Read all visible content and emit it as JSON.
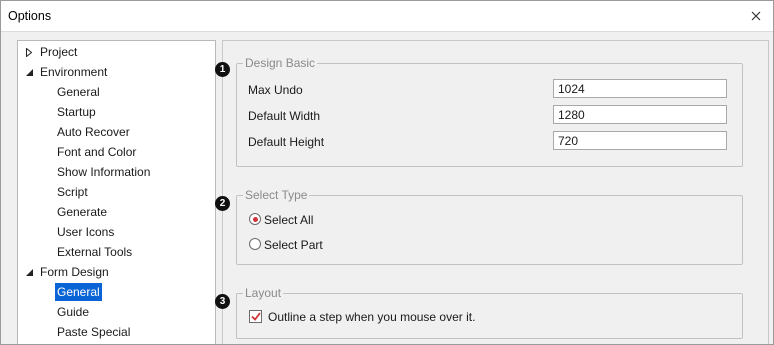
{
  "window": {
    "title": "Options"
  },
  "tree": {
    "project": "Project",
    "environment": "Environment",
    "environment_children": [
      "General",
      "Startup",
      "Auto Recover",
      "Font and Color",
      "Show Information",
      "Script",
      "Generate",
      "User Icons",
      "External Tools"
    ],
    "form_design": "Form Design",
    "form_design_children": [
      "General",
      "Guide",
      "Paste Special"
    ],
    "selected": "Form Design > General"
  },
  "design_basic": {
    "title": "Design Basic",
    "max_undo_label": "Max Undo",
    "max_undo_value": "1024",
    "default_width_label": "Default Width",
    "default_width_value": "1280",
    "default_height_label": "Default Height",
    "default_height_value": "720"
  },
  "select_type": {
    "title": "Select Type",
    "option_all": "Select All",
    "option_part": "Select Part",
    "selected": "Select All"
  },
  "layout": {
    "title": "Layout",
    "outline_label": "Outline a step when you mouse over it.",
    "outline_checked": true
  },
  "badges": [
    "1",
    "2",
    "3"
  ],
  "colors": {
    "selection": "#0a64d6",
    "radio_dot": "#d0343a",
    "checkmark": "#d0343a",
    "badge": "#111111"
  }
}
